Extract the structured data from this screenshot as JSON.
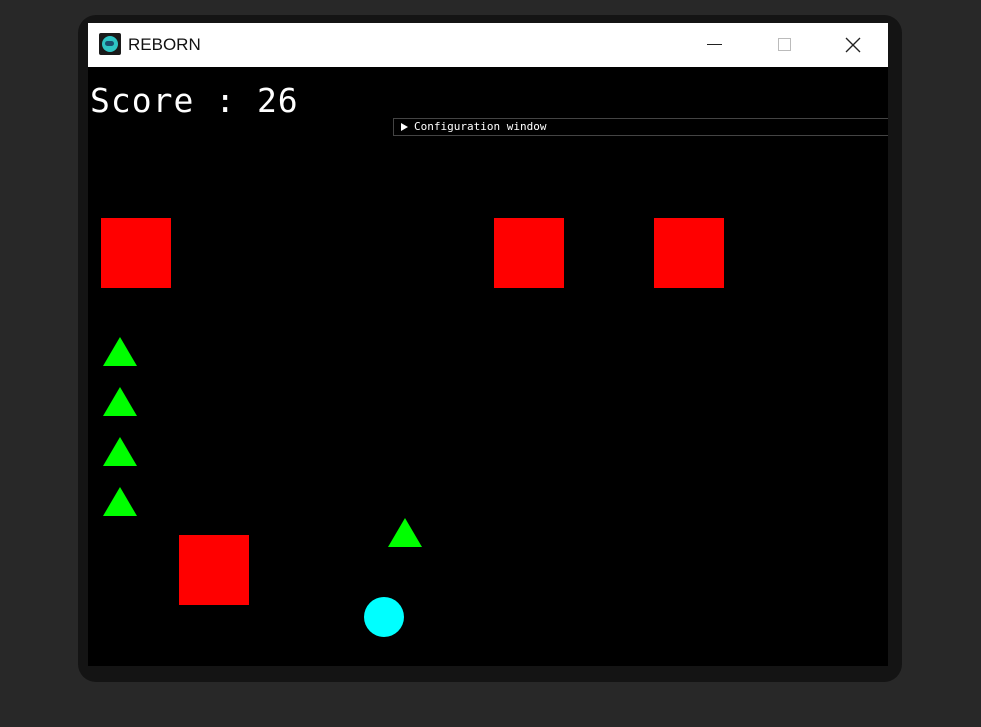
{
  "window": {
    "title": "REBORN",
    "icon": "app-globe-icon",
    "controls": [
      "minimize-icon",
      "maximize-icon",
      "close-icon"
    ]
  },
  "hud": {
    "score_label": "Score : 26"
  },
  "config_panel": {
    "label": "Configuration window",
    "state": "collapsed"
  },
  "colors": {
    "background": "#000000",
    "enemy": "#ff0000",
    "life": "#00ff00",
    "projectile": "#00ff00",
    "player": "#00ffff",
    "text": "#ffffff"
  },
  "entities": {
    "enemies": 4,
    "lives": 4,
    "projectiles": 1,
    "players": 1
  }
}
